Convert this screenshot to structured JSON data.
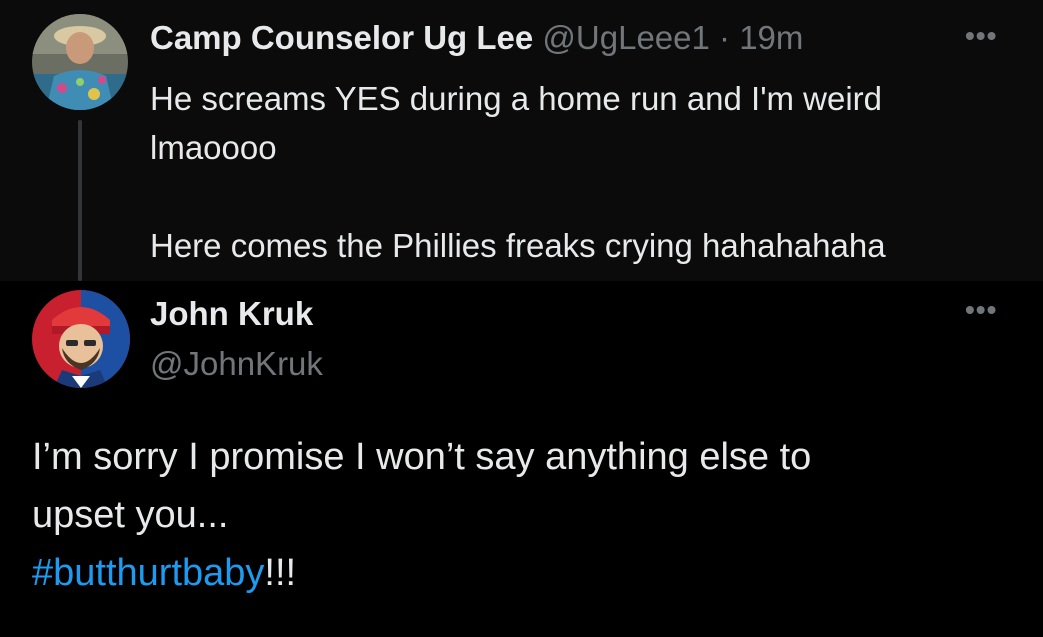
{
  "quoted_tweet": {
    "display_name": "Camp Counselor Ug Lee",
    "handle": "@UgLeee1",
    "separator": "·",
    "time": "19m",
    "text_line1": "He screams YES during a home run and I'm weird",
    "text_line2": "lmaoooo",
    "text_line3": "Here comes the Phillies freaks crying hahahahaha",
    "more_icon": "more-horizontal-icon"
  },
  "reply_tweet": {
    "display_name": "John Kruk",
    "handle": "@JohnKruk",
    "text_line1": "I’m sorry I promise I won’t say anything else to",
    "text_line2": "upset you...",
    "hashtag": "#butthurtbaby",
    "hashtag_suffix": "!!!",
    "more_icon": "more-horizontal-icon"
  },
  "colors": {
    "background": "#000000",
    "text_primary": "#e7e9ea",
    "text_secondary": "#71767b",
    "link": "#1d9bf0"
  }
}
